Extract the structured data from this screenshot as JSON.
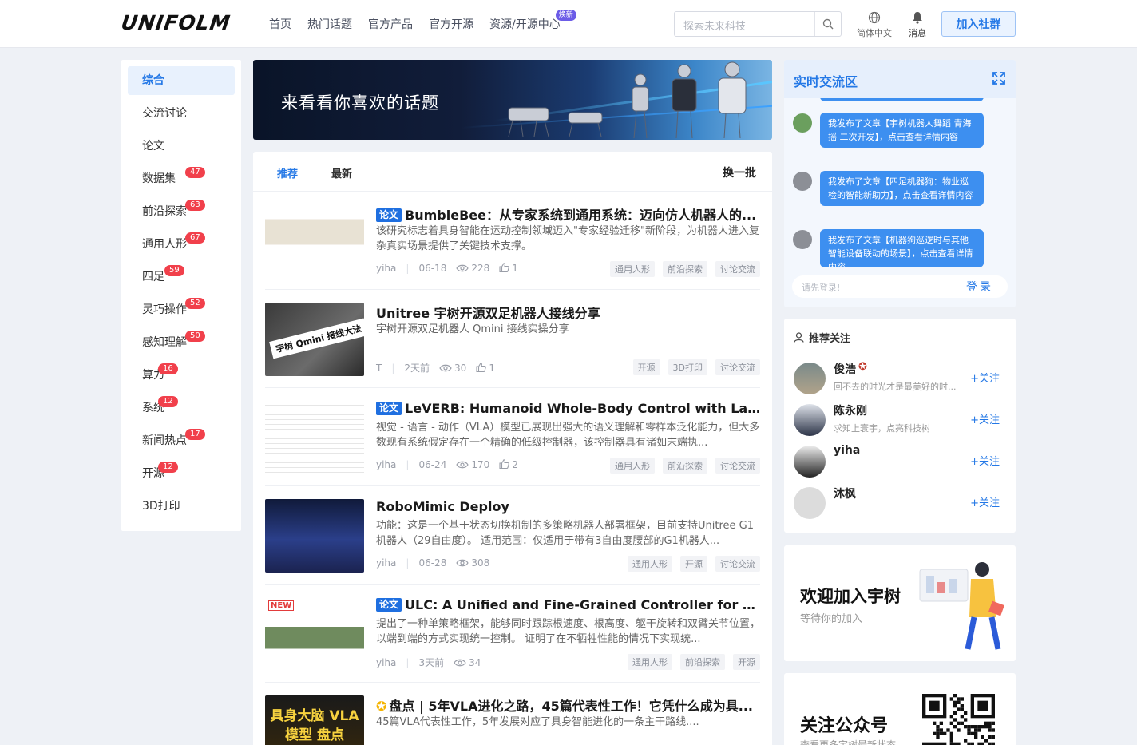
{
  "header": {
    "logo": "UNIFOLM",
    "nav": [
      "首页",
      "热门话题",
      "官方产品",
      "官方开源",
      "资源/开源中心"
    ],
    "nav_badge": "焕新",
    "search_placeholder": "探索未来科技",
    "lang": "简体中文",
    "messages": "消息",
    "join": "加入社群"
  },
  "sidebar": {
    "items": [
      {
        "label": "综合",
        "count": null
      },
      {
        "label": "交流讨论",
        "count": null
      },
      {
        "label": "论文",
        "count": null
      },
      {
        "label": "数据集",
        "count": "47"
      },
      {
        "label": "前沿探索",
        "count": "63"
      },
      {
        "label": "通用人形",
        "count": "67"
      },
      {
        "label": "四足",
        "count": "59"
      },
      {
        "label": "灵巧操作",
        "count": "52"
      },
      {
        "label": "感知理解",
        "count": "50"
      },
      {
        "label": "算力",
        "count": "16"
      },
      {
        "label": "系统",
        "count": "12"
      },
      {
        "label": "新闻热点",
        "count": "17"
      },
      {
        "label": "开源",
        "count": "12"
      },
      {
        "label": "3D打印",
        "count": null
      }
    ]
  },
  "banner": {
    "title": "来看看你喜欢的话题"
  },
  "feed": {
    "tabs": [
      "推荐",
      "最新"
    ],
    "refresh": "换一批",
    "articles": [
      {
        "tag": "论文",
        "title": "BumbleBee：从专家系统到通用系统：迈向仿人机器人的...",
        "desc": "该研究标志着具身智能在运动控制领域迈入\"专家经验迁移\"新阶段，为机器人进入复杂真实场景提供了关键技术支撑。",
        "author": "yiha",
        "date": "06-18",
        "views": "228",
        "likes": "1",
        "tags": [
          "通用人形",
          "前沿探索",
          "讨论交流"
        ]
      },
      {
        "tag": "",
        "title": "Unitree 宇树开源双足机器人接线分享",
        "desc": "宇树开源双足机器人 Qmini 接线实操分享",
        "author": "T",
        "date": "2天前",
        "views": "30",
        "likes": "1",
        "tags": [
          "开源",
          "3D打印",
          "讨论交流"
        ],
        "thumb_text": "宇树 Qmini 接线大法"
      },
      {
        "tag": "论文",
        "title": "LeVERB: Humanoid Whole-Body Control with Latent ...",
        "desc": "视觉 - 语言 - 动作（VLA）模型已展现出强大的语义理解和零样本泛化能力，但大多数现有系统假定存在一个精确的低级控制器，该控制器具有诸如末端执...",
        "author": "yiha",
        "date": "06-24",
        "views": "170",
        "likes": "2",
        "tags": [
          "通用人形",
          "前沿探索",
          "讨论交流"
        ]
      },
      {
        "tag": "",
        "title": "RoboMimic Deploy",
        "desc": "功能：这是一个基于状态切换机制的多策略机器人部署框架，目前支持Unitree G1机器人（29自由度）。 适用范围：仅适用于带有3自由度腰部的G1机器人...",
        "author": "yiha",
        "date": "06-28",
        "views": "308",
        "likes": "",
        "tags": [
          "通用人形",
          "开源",
          "讨论交流"
        ]
      },
      {
        "tag": "论文",
        "title": "ULC: A Unified and Fine-Grained Controller for Hum...",
        "desc": "提出了一种单策略框架，能够同时跟踪根速度、根高度、躯干旋转和双臂关节位置，以端到端的方式实现统一控制。 证明了在不牺牲性能的情况下实现统...",
        "author": "yiha",
        "date": "3天前",
        "views": "34",
        "likes": "",
        "tags": [
          "通用人形",
          "前沿探索",
          "开源"
        ],
        "thumb_badge": "NEW"
      },
      {
        "tag": "",
        "title": "盘点 | 5年VLA进化之路，45篇代表性工作！它凭什么成为具...",
        "desc": "45篇VLA代表性工作，5年发展对应了具身智能进化的一条主干路线....",
        "author": "",
        "date": "",
        "views": "",
        "likes": "",
        "tags": [],
        "thumb_text": "具身大脑 VLA模型 盘点"
      }
    ]
  },
  "chat": {
    "title": "实时交流区",
    "messages": [
      "我发布了文章【宇树机器人舞蹈 青海摇 二次开发】，点击查看详情内容",
      "我发布了文章【四足机器狗：物业巡检的智能新助力】，点击查看详情内容",
      "我发布了文章【机器狗巡逻时与其他智能设备联动的场景】，点击查看详情内容"
    ],
    "input_placeholder": "请先登录!",
    "login": "登录"
  },
  "follow": {
    "title": "推荐关注",
    "users": [
      {
        "name": "俊浩",
        "sig": "回不去的时光才是最美好的时...",
        "btn": "+关注"
      },
      {
        "name": "陈永刚",
        "sig": "求知上寰宇，点亮科技树",
        "btn": "+关注"
      },
      {
        "name": "yiha",
        "sig": "",
        "btn": "+关注"
      },
      {
        "name": "沐枫",
        "sig": "",
        "btn": "+关注"
      }
    ]
  },
  "welcome": {
    "title": "欢迎加入宇树",
    "sub": "等待你的加入"
  },
  "qr": {
    "title": "关注公众号",
    "sub": "查看更多宇树最新状态"
  },
  "colors": {
    "accent": "#2478e6",
    "badge": "#f1404b",
    "bubble": "#3d8ff0"
  }
}
